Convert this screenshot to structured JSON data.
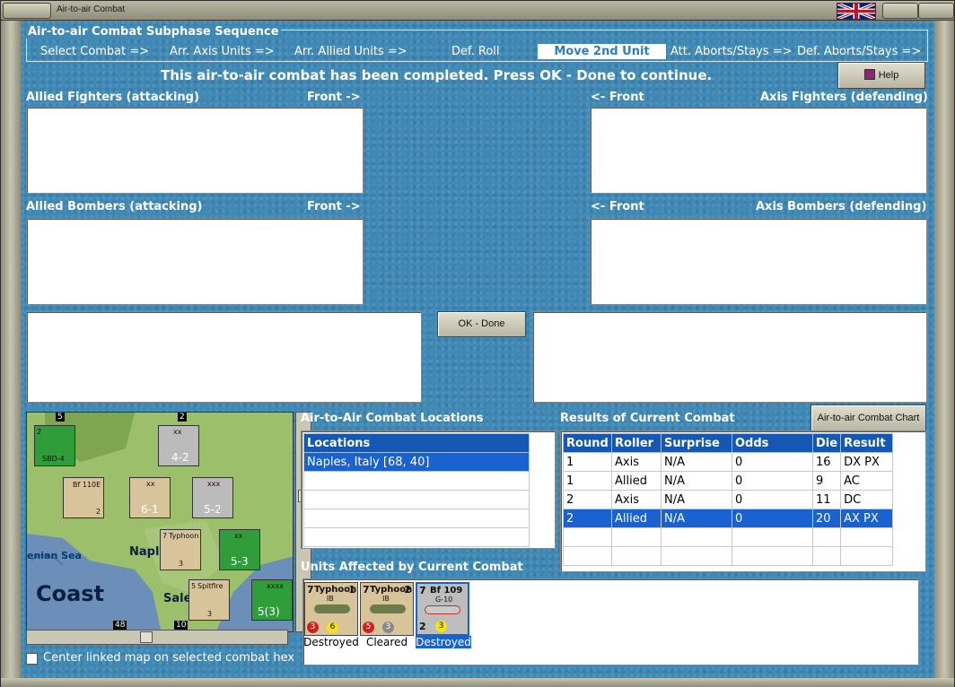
{
  "window": {
    "title": "Air-to-air Combat"
  },
  "subphase": {
    "title": "Air-to-air Combat Subphase Sequence",
    "steps": [
      "Select Combat =>",
      "Arr. Axis Units =>",
      "Arr. Allied Units =>",
      "Def. Roll",
      "Move 2nd Unit",
      "Att. Aborts/Stays =>",
      "Def. Aborts/Stays =>"
    ],
    "active_step_index": 4
  },
  "status_message": "This air-to-air combat has been completed.  Press OK - Done to continue.",
  "help_button": "Help",
  "panels": {
    "allied_fighters": "Allied Fighters (attacking)",
    "allied_fighters_front": "Front ->",
    "axis_fighters_front": "<- Front",
    "axis_fighters": "Axis Fighters (defending)",
    "allied_bombers": "Allied Bombers (attacking)",
    "allied_bombers_front": "Front ->",
    "axis_bombers_front": "<- Front",
    "axis_bombers": "Axis Bombers (defending)"
  },
  "ok_done_button": "OK - Done",
  "map": {
    "labels": {
      "sea": "enian Sea",
      "coast": "Coast",
      "city1": "Napl",
      "city2": "Sale"
    },
    "counters": [
      {
        "top": "2",
        "name": "SBD-4",
        "bottom": "2"
      },
      {
        "top": "",
        "name": "Bf 110E",
        "bottom": "2"
      },
      {
        "top": "",
        "name": "xx",
        "bottom": "4-2"
      },
      {
        "top": "",
        "name": "xx",
        "bottom": "6-1"
      },
      {
        "top": "",
        "name": "xxx",
        "bottom": "5-2"
      },
      {
        "top": "7",
        "name": "Typhoon",
        "bottom": "3"
      },
      {
        "top": "",
        "name": "xx",
        "bottom": "5-3"
      },
      {
        "top": "5",
        "name": "Spitfire",
        "bottom": "3"
      },
      {
        "top": "",
        "name": "xxxx",
        "bottom": "5(3)"
      }
    ],
    "numbers": [
      "5",
      "2",
      "2",
      "3",
      "3",
      "48",
      "10",
      "2"
    ],
    "center_checkbox_label": "Center linked map on selected combat hex",
    "center_checkbox_checked": false
  },
  "locations": {
    "section_label": "Air-to-Air Combat Locations",
    "header": "Locations",
    "rows": [
      "Naples, Italy [68, 40]",
      "",
      "",
      "",
      ""
    ],
    "selected_index": 0
  },
  "results": {
    "section_label": "Results of Current Combat",
    "chart_button": "Air-to-air Combat Chart",
    "headers": [
      "Round",
      "Roller",
      "Surprise",
      "Odds",
      "Die",
      "Result"
    ],
    "rows": [
      [
        "1",
        "Axis",
        "N/A",
        "0",
        "16",
        "DX PX"
      ],
      [
        "1",
        "Allied",
        "N/A",
        "0",
        "9",
        "AC"
      ],
      [
        "2",
        "Axis",
        "N/A",
        "0",
        "11",
        "DC"
      ],
      [
        "2",
        "Allied",
        "N/A",
        "0",
        "20",
        "AX PX"
      ],
      [
        "",
        "",
        "",
        "",
        "",
        ""
      ],
      [
        "",
        "",
        "",
        "",
        "",
        ""
      ]
    ],
    "selected_index": 3
  },
  "affected": {
    "section_label": "Units Affected by Current Combat",
    "units": [
      {
        "left_top": "7",
        "name": "Typhoon",
        "sub": "IB",
        "right_top": "1",
        "red": "3",
        "yellow": "6",
        "status": "Destroyed",
        "selected": false
      },
      {
        "left_top": "7",
        "name": "Typhoon",
        "sub": "IB",
        "right_top": "2",
        "red": "5",
        "yellow": "3",
        "status": "Cleared",
        "selected": false
      },
      {
        "left_top": "7",
        "name": "Bf 109",
        "sub": "G-10",
        "right_top": "",
        "red": "2",
        "yellow": "3",
        "status": "Destroyed",
        "selected": true
      }
    ]
  }
}
